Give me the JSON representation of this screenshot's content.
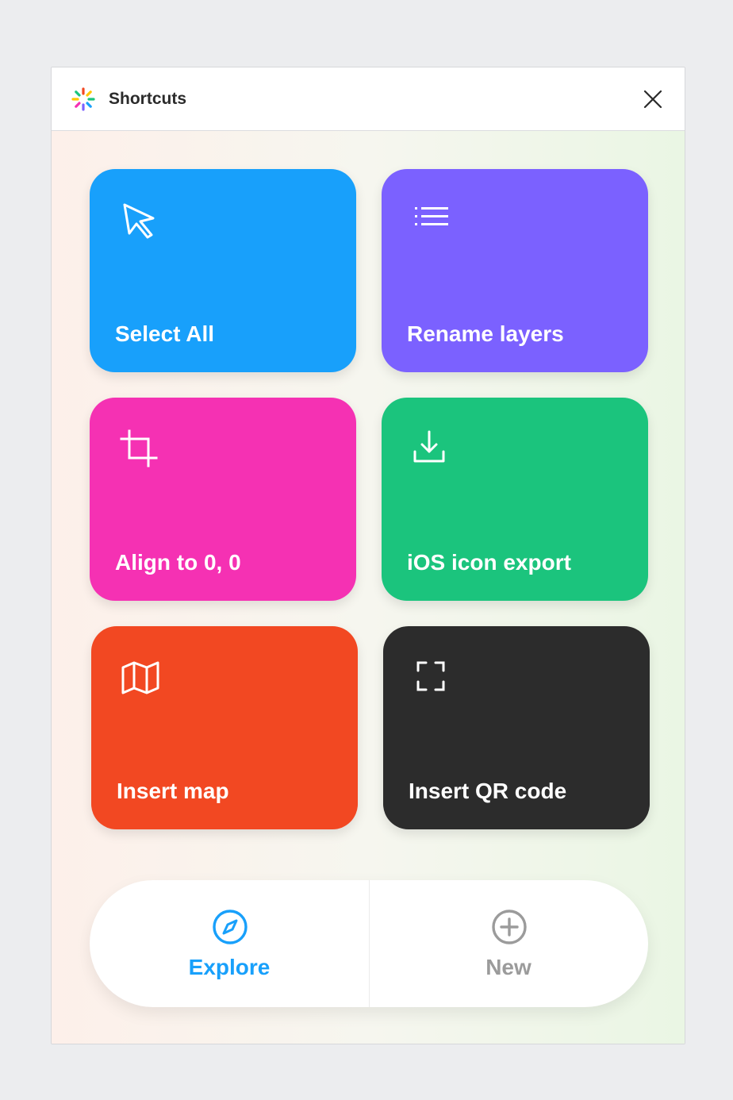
{
  "window": {
    "title": "Shortcuts",
    "logo_icon": "sparkle-logo-icon",
    "close_icon": "close-icon"
  },
  "tiles": [
    {
      "label": "Select All",
      "icon": "cursor-arrow-icon",
      "color": "#18A0FB"
    },
    {
      "label": "Rename layers",
      "icon": "list-icon",
      "color": "#7B61FF"
    },
    {
      "label": "Align to 0, 0",
      "icon": "crop-icon",
      "color": "#F531B3"
    },
    {
      "label": "iOS icon export",
      "icon": "download-icon",
      "color": "#1BC47D"
    },
    {
      "label": "Insert map",
      "icon": "map-icon",
      "color": "#F24822"
    },
    {
      "label": "Insert QR code",
      "icon": "scan-frame-icon",
      "color": "#2C2C2C"
    }
  ],
  "nav": {
    "explore": {
      "label": "Explore",
      "icon": "compass-icon",
      "color": "#18A0FB",
      "active": true
    },
    "new": {
      "label": "New",
      "icon": "plus-circle-icon",
      "color": "#9B9B9B",
      "active": false
    }
  }
}
